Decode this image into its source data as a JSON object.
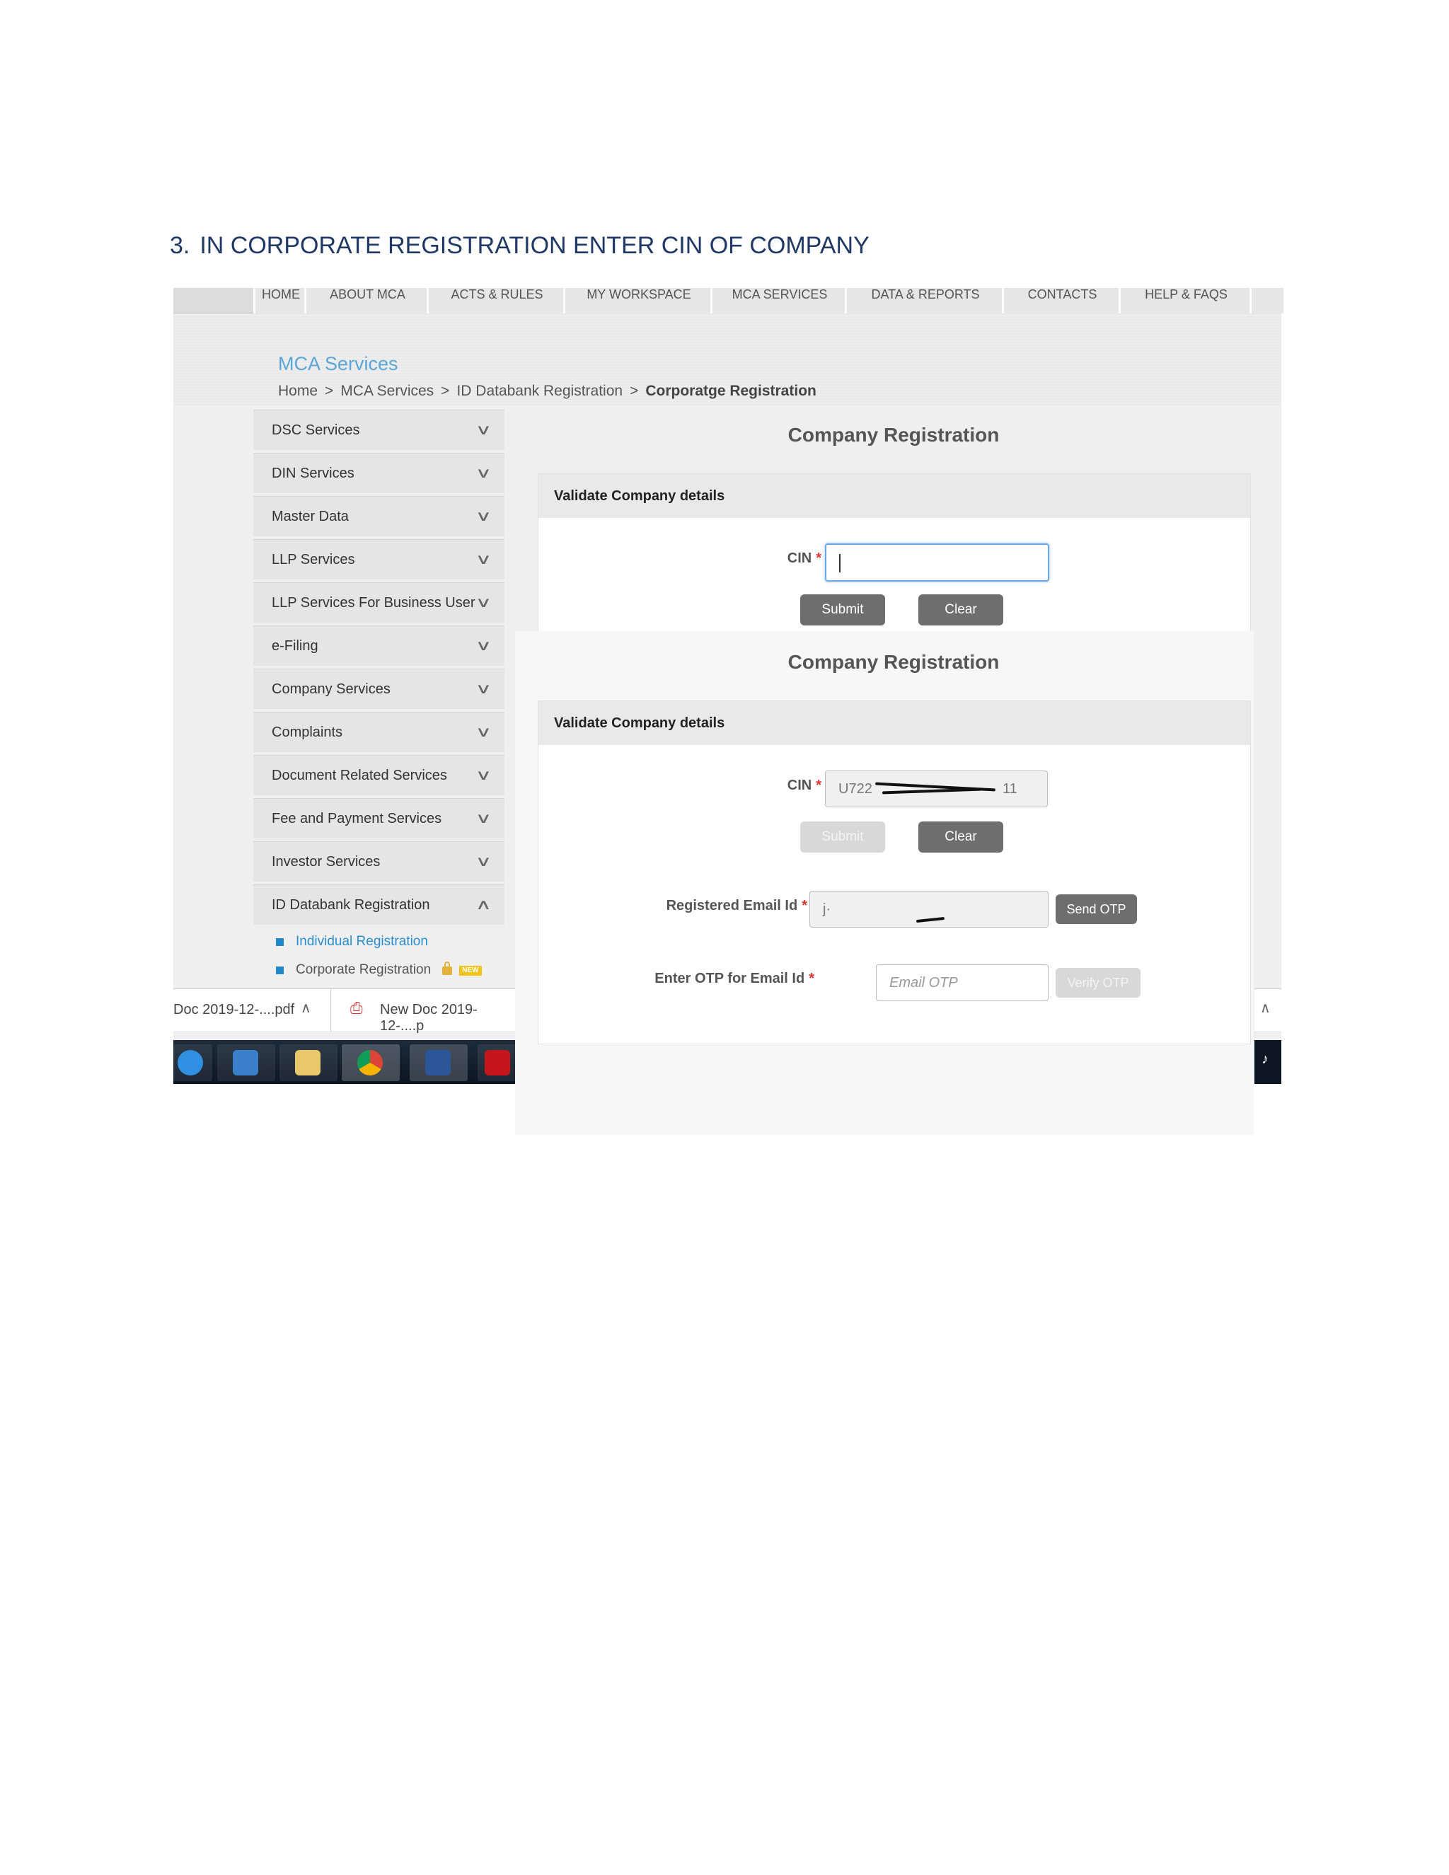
{
  "document": {
    "step_number": "3.",
    "heading": "IN CORPORATE REGISTRATION ENTER CIN OF COMPANY"
  },
  "nav": {
    "items": [
      "HOME",
      "ABOUT MCA",
      "ACTS & RULES",
      "MY WORKSPACE",
      "MCA SERVICES",
      "DATA & REPORTS",
      "CONTACTS",
      "HELP & FAQS"
    ]
  },
  "banner": {
    "title": "MCA Services",
    "breadcrumb": [
      "Home",
      "MCA Services",
      "ID Databank Registration",
      "Corporatge Registration"
    ],
    "separator": ">"
  },
  "sidebar": {
    "items": [
      "DSC Services",
      "DIN Services",
      "Master Data",
      "LLP Services",
      "LLP Services For Business User",
      "e-Filing",
      "Company Services",
      "Complaints",
      "Document Related Services",
      "Fee and Payment Services",
      "Investor Services",
      "ID Databank Registration"
    ],
    "subitems": [
      "Individual Registration",
      "Corporate Registration"
    ],
    "new_badge": "NEW"
  },
  "form1": {
    "title": "Company Registration",
    "panel_heading": "Validate Company details",
    "cin_label": "CIN",
    "required_mark": "*",
    "submit_label": "Submit",
    "clear_label": "Clear"
  },
  "form2": {
    "title": "Company Registration",
    "panel_heading": "Validate Company details",
    "cin_label": "CIN",
    "cin_value": "U722",
    "cin_value_tail": "11",
    "required_mark": "*",
    "submit_label": "Submit",
    "clear_label": "Clear",
    "email_label": "Registered Email Id",
    "email_value": "j·",
    "send_otp_label": "Send OTP",
    "otp_label": "Enter OTP for Email Id",
    "otp_placeholder": "Email OTP",
    "verify_otp_label": "Verify OTP"
  },
  "downloads": {
    "item1": "Doc 2019-12-....pdf",
    "item2": "New Doc 2019-12-....p"
  },
  "colors": {
    "heading": "#1f3864",
    "link_blue": "#2a8ed0",
    "button_gray": "#6e6e6e",
    "required_red": "#d33333"
  }
}
